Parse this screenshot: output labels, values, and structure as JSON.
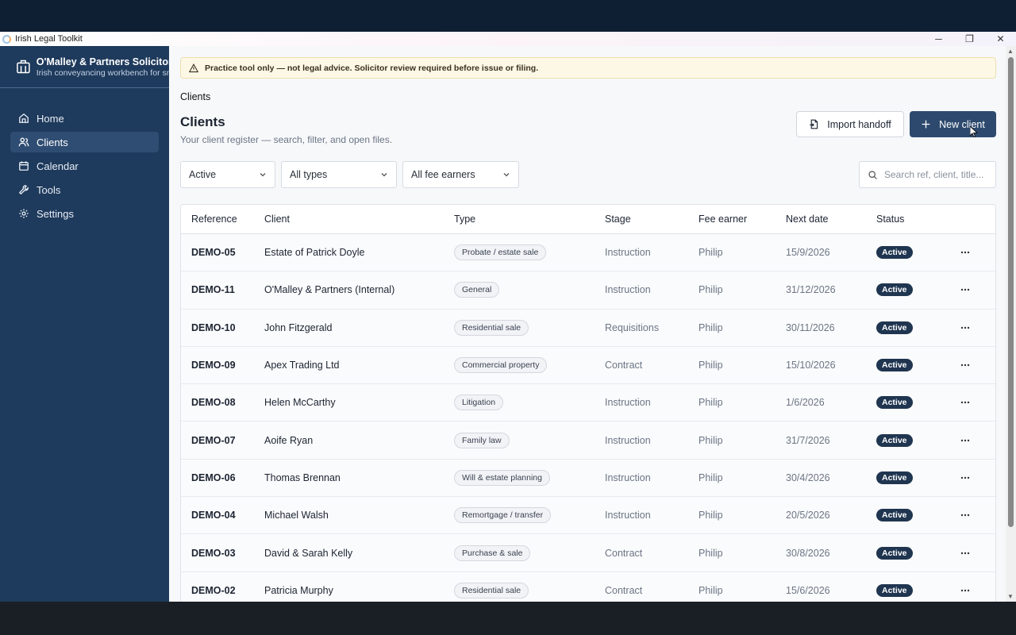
{
  "window": {
    "title": "Irish Legal Toolkit",
    "controls": {
      "minimize": "─",
      "maximize": "❐",
      "close": "✕"
    }
  },
  "sidebar": {
    "brand_name": "O'Malley & Partners Solicitors",
    "brand_sub": "Irish conveyancing workbench for sma",
    "items": [
      {
        "label": "Home",
        "icon": "home-icon"
      },
      {
        "label": "Clients",
        "icon": "users-icon"
      },
      {
        "label": "Calendar",
        "icon": "calendar-icon"
      },
      {
        "label": "Tools",
        "icon": "wrench-icon"
      },
      {
        "label": "Settings",
        "icon": "gear-icon"
      }
    ],
    "active": "Clients"
  },
  "banner": {
    "text": "Practice tool only — not legal advice. Solicitor review required before issue or filing."
  },
  "breadcrumb": "Clients",
  "page": {
    "title": "Clients",
    "subtitle": "Your client register — search, filter, and open files."
  },
  "actions": {
    "import_label": "Import handoff",
    "new_label": "New client"
  },
  "filters": {
    "status": "Active",
    "type": "All types",
    "fee_earner": "All fee earners"
  },
  "search": {
    "placeholder": "Search ref, client, title..."
  },
  "table": {
    "headers": {
      "reference": "Reference",
      "client": "Client",
      "type": "Type",
      "stage": "Stage",
      "fee_earner": "Fee earner",
      "next_date": "Next date",
      "status": "Status"
    },
    "rows": [
      {
        "ref": "DEMO-05",
        "client": "Estate of Patrick Doyle",
        "type": "Probate / estate sale",
        "stage": "Instruction",
        "fee": "Philip",
        "date": "15/9/2026",
        "status": "Active"
      },
      {
        "ref": "DEMO-11",
        "client": "O'Malley & Partners (Internal)",
        "type": "General",
        "stage": "Instruction",
        "fee": "Philip",
        "date": "31/12/2026",
        "status": "Active"
      },
      {
        "ref": "DEMO-10",
        "client": "John Fitzgerald",
        "type": "Residential sale",
        "stage": "Requisitions",
        "fee": "Philip",
        "date": "30/11/2026",
        "status": "Active"
      },
      {
        "ref": "DEMO-09",
        "client": "Apex Trading Ltd",
        "type": "Commercial property",
        "stage": "Contract",
        "fee": "Philip",
        "date": "15/10/2026",
        "status": "Active"
      },
      {
        "ref": "DEMO-08",
        "client": "Helen McCarthy",
        "type": "Litigation",
        "stage": "Instruction",
        "fee": "Philip",
        "date": "1/6/2026",
        "status": "Active"
      },
      {
        "ref": "DEMO-07",
        "client": "Aoife Ryan",
        "type": "Family law",
        "stage": "Instruction",
        "fee": "Philip",
        "date": "31/7/2026",
        "status": "Active"
      },
      {
        "ref": "DEMO-06",
        "client": "Thomas Brennan",
        "type": "Will & estate planning",
        "stage": "Instruction",
        "fee": "Philip",
        "date": "30/4/2026",
        "status": "Active"
      },
      {
        "ref": "DEMO-04",
        "client": "Michael Walsh",
        "type": "Remortgage / transfer",
        "stage": "Instruction",
        "fee": "Philip",
        "date": "20/5/2026",
        "status": "Active"
      },
      {
        "ref": "DEMO-03",
        "client": "David & Sarah Kelly",
        "type": "Purchase & sale",
        "stage": "Contract",
        "fee": "Philip",
        "date": "30/8/2026",
        "status": "Active"
      },
      {
        "ref": "DEMO-02",
        "client": "Patricia Murphy",
        "type": "Residential sale",
        "stage": "Contract",
        "fee": "Philip",
        "date": "15/6/2026",
        "status": "Active"
      }
    ]
  },
  "colors": {
    "sidebar": "#1e3a5c",
    "accent": "#2d4a6e",
    "badge": "#1f3550",
    "banner": "#fdf8e6"
  }
}
